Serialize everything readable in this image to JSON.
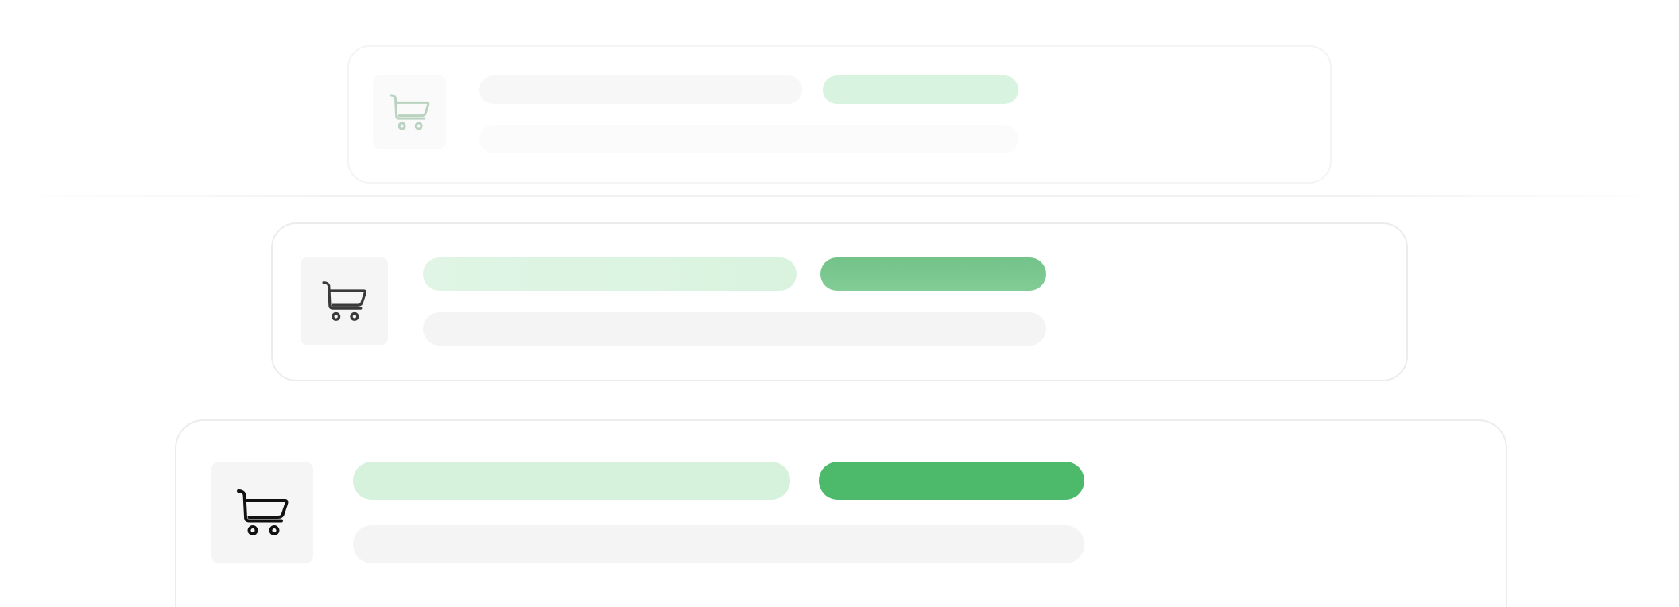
{
  "screen": {
    "description_visible_text": ""
  },
  "cards": [
    {
      "id": "card-1",
      "icon": "cart-icon",
      "opacity_state": "faded",
      "accent_color": "#d8f3df",
      "icon_color": "#b9d3c0"
    },
    {
      "id": "card-2",
      "icon": "cart-icon",
      "opacity_state": "mid",
      "accent_color": "#79c790",
      "icon_color": "#3a3a3a"
    },
    {
      "id": "card-3",
      "icon": "cart-icon",
      "opacity_state": "full",
      "accent_color": "#4db96b",
      "icon_color": "#111111"
    }
  ],
  "colors": {
    "card_border": "#ececec",
    "placeholder_gray": "#f4f4f4",
    "placeholder_green_light": "#d6f2dc",
    "accent_green": "#4db96b",
    "thumb_bg": "#f5f5f5"
  }
}
